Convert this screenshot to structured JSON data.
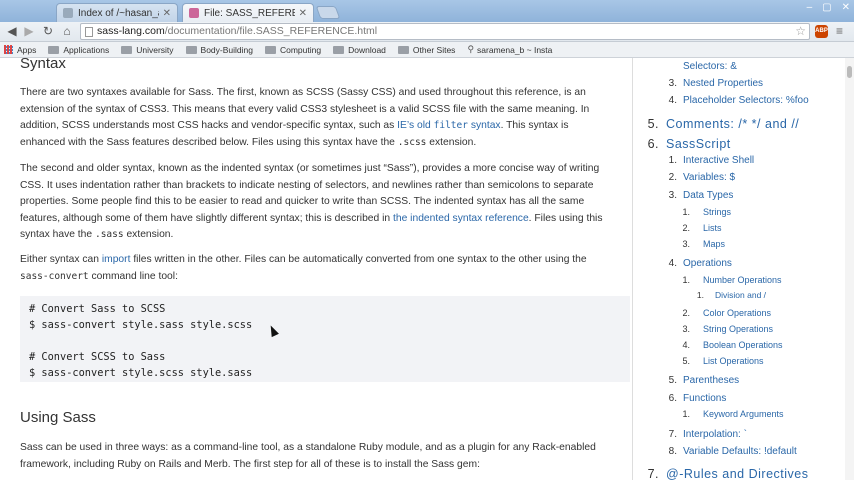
{
  "browser": {
    "tabs": [
      {
        "title": "Index of /~hasan_azimi/",
        "active": false
      },
      {
        "title": "File: SASS_REFERENCE — S",
        "active": true
      }
    ],
    "url_host": "sass-lang.com",
    "url_path": "/documentation/file.SASS_REFERENCE.html",
    "bookmarks": [
      "Apps",
      "Applications",
      "University",
      "Body-Building",
      "Computing",
      "Download",
      "Other Sites",
      "saramena_b ~ Insta"
    ]
  },
  "main": {
    "syntax_heading": "Syntax",
    "p1_a": "There are two syntaxes available for Sass. The first, known as SCSS (Sassy CSS) and used throughout this reference, is an extension of the syntax of CSS3. This means that every valid CSS3 stylesheet is a valid SCSS file with the same meaning. In addition, SCSS understands most CSS hacks and vendor-specific syntax, such as ",
    "p1_link_a": "IE’s old ",
    "p1_link_code": "filter",
    "p1_link_b": " syntax",
    "p1_b": ". This syntax is enhanced with the Sass features described below. Files using this syntax have the ",
    "p1_code": ".scss",
    "p1_c": " extension.",
    "p2_a": "The second and older syntax, known as the indented syntax (or sometimes just “Sass”), provides a more concise way of writing CSS. It uses indentation rather than brackets to indicate nesting of selectors, and newlines rather than semicolons to separate properties. Some people find this to be easier to read and quicker to write than SCSS. The indented syntax has all the same features, although some of them have slightly different syntax; this is described in ",
    "p2_link": "the indented syntax reference",
    "p2_b": ". Files using this syntax have the ",
    "p2_code": ".sass",
    "p2_c": " extension.",
    "p3_a": "Either syntax can ",
    "p3_link": "import",
    "p3_b": " files written in the other. Files can be automatically converted from one syntax to the other using the ",
    "p3_code": "sass-convert",
    "p3_c": " command line tool:",
    "code_lines": [
      "# Convert Sass to SCSS",
      "$ sass-convert style.sass style.scss",
      "# Convert SCSS to Sass",
      "$ sass-convert style.scss style.sass"
    ],
    "using_heading": "Using Sass",
    "p4": "Sass can be used in three ways: as a command-line tool, as a standalone Ruby module, and as a plugin for any Rack-enabled framework, including Ruby on Rails and Merb. The first step for all of these is to install the Sass gem:"
  },
  "toc": [
    {
      "num": "",
      "label": "Selectors: &",
      "level": 2
    },
    {
      "num": "3.",
      "label": "Nested Properties",
      "level": 2
    },
    {
      "num": "4.",
      "label": "Placeholder Selectors: %foo",
      "level": 2
    },
    {
      "num": "5.",
      "label": "Comments: /* */ and //",
      "level": 1
    },
    {
      "num": "6.",
      "label": "SassScript",
      "level": 1
    },
    {
      "num": "1.",
      "label": "Interactive Shell",
      "level": 2
    },
    {
      "num": "2.",
      "label": "Variables: $",
      "level": 2
    },
    {
      "num": "3.",
      "label": "Data Types",
      "level": 2
    },
    {
      "num": "1.",
      "label": "Strings",
      "level": 3
    },
    {
      "num": "2.",
      "label": "Lists",
      "level": 3
    },
    {
      "num": "3.",
      "label": "Maps",
      "level": 3
    },
    {
      "num": "4.",
      "label": "Operations",
      "level": 2
    },
    {
      "num": "1.",
      "label": "Number Operations",
      "level": 3
    },
    {
      "num": "1.",
      "label": "Division and /",
      "level": 4
    },
    {
      "num": "2.",
      "label": "Color Operations",
      "level": 3
    },
    {
      "num": "3.",
      "label": "String Operations",
      "level": 3
    },
    {
      "num": "4.",
      "label": "Boolean Operations",
      "level": 3
    },
    {
      "num": "5.",
      "label": "List Operations",
      "level": 3
    },
    {
      "num": "5.",
      "label": "Parentheses",
      "level": 2
    },
    {
      "num": "6.",
      "label": "Functions",
      "level": 2
    },
    {
      "num": "1.",
      "label": "Keyword Arguments",
      "level": 3
    },
    {
      "num": "7.",
      "label": "Interpolation: `",
      "level": 2
    },
    {
      "num": "8.",
      "label": "Variable Defaults: !default",
      "level": 2
    },
    {
      "num": "7.",
      "label": "@-Rules and Directives",
      "level": 1
    }
  ],
  "icons": {
    "back": "back-arrow-icon",
    "forward": "forward-arrow-icon",
    "reload": "reload-icon",
    "home": "home-icon",
    "star": "star-icon",
    "menu": "menu-icon",
    "adblock": "adblock-icon"
  },
  "adblock_label": "ABP",
  "colors": {
    "link": "#2a67a8",
    "code_bg": "#f2f3f6"
  }
}
